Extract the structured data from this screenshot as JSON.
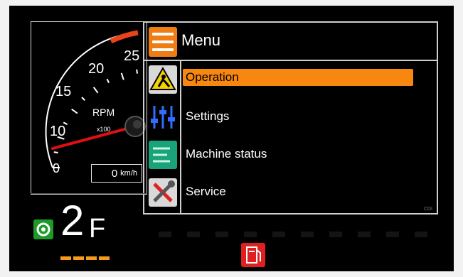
{
  "gauge": {
    "rpm_label": "RPM",
    "multiplier": "x100",
    "ticks": [
      "0",
      "10",
      "15",
      "20",
      "25"
    ],
    "rpm_value_x100": 0
  },
  "speed": {
    "value": "0",
    "unit": "km/h"
  },
  "menu": {
    "title": "Menu",
    "items": [
      {
        "label": "Operation",
        "icon": "operation-worker-icon",
        "active": true
      },
      {
        "label": "Settings",
        "icon": "sliders-icon",
        "active": false
      },
      {
        "label": "Machine status",
        "icon": "machine-status-icon",
        "active": false
      },
      {
        "label": "Service",
        "icon": "tools-icon",
        "active": false
      }
    ],
    "corner_mark": "CDI"
  },
  "gear": {
    "number": "2",
    "direction": "F",
    "icon": "transmission-gear-icon"
  },
  "warning": {
    "icon": "fuel-warning-icon",
    "color": "#e02020"
  },
  "colors": {
    "accent": "#f7870f",
    "green": "#1c9a2a",
    "red": "#e02020"
  }
}
